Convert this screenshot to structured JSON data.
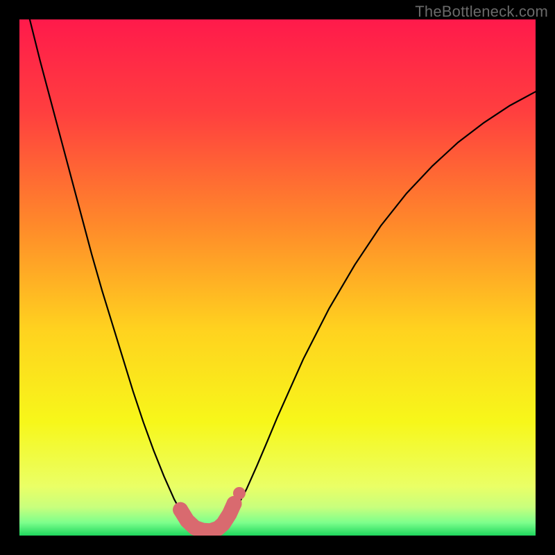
{
  "watermark": "TheBottleneck.com",
  "chart_data": {
    "type": "line",
    "title": "",
    "xlabel": "",
    "ylabel": "",
    "xlim": [
      0,
      100
    ],
    "ylim": [
      0,
      100
    ],
    "series": [
      {
        "name": "bottleneck-curve",
        "x": [
          0,
          2,
          4,
          6,
          8,
          10,
          12,
          14,
          16,
          18,
          20,
          22,
          24,
          26,
          28,
          30,
          31,
          32,
          33,
          34,
          35,
          36,
          37,
          38,
          39,
          40,
          42,
          44,
          46,
          48,
          50,
          55,
          60,
          65,
          70,
          75,
          80,
          85,
          90,
          95,
          100
        ],
        "y": [
          108,
          100,
          92,
          84.5,
          77,
          69.5,
          62,
          54.5,
          47.5,
          41,
          34.5,
          28,
          22,
          16.5,
          11.5,
          7,
          5.2,
          3.6,
          2.4,
          1.5,
          1.0,
          0.8,
          0.8,
          1.0,
          1.6,
          2.5,
          5.2,
          9,
          13.5,
          18.2,
          23,
          34.2,
          44,
          52.5,
          60,
          66.3,
          71.6,
          76.2,
          80,
          83.3,
          86
        ]
      }
    ],
    "highlight_band": {
      "name": "optimal-zone-marker",
      "color": "#d96a6f",
      "points_x": [
        31.2,
        32.5,
        34,
        35.5,
        37,
        38.5,
        39.5,
        40.7,
        41.6
      ],
      "points_y": [
        5.0,
        2.9,
        1.5,
        1.0,
        0.9,
        1.4,
        2.3,
        4.2,
        6.2
      ]
    },
    "background_gradient": {
      "stops": [
        {
          "offset": 0.0,
          "color": "#ff1a4b"
        },
        {
          "offset": 0.18,
          "color": "#ff3f3f"
        },
        {
          "offset": 0.4,
          "color": "#ff8a2a"
        },
        {
          "offset": 0.6,
          "color": "#ffd21f"
        },
        {
          "offset": 0.78,
          "color": "#f7f71a"
        },
        {
          "offset": 0.905,
          "color": "#eaff66"
        },
        {
          "offset": 0.945,
          "color": "#c8ff7d"
        },
        {
          "offset": 0.975,
          "color": "#7dff8c"
        },
        {
          "offset": 1.0,
          "color": "#1fd65d"
        }
      ]
    }
  }
}
